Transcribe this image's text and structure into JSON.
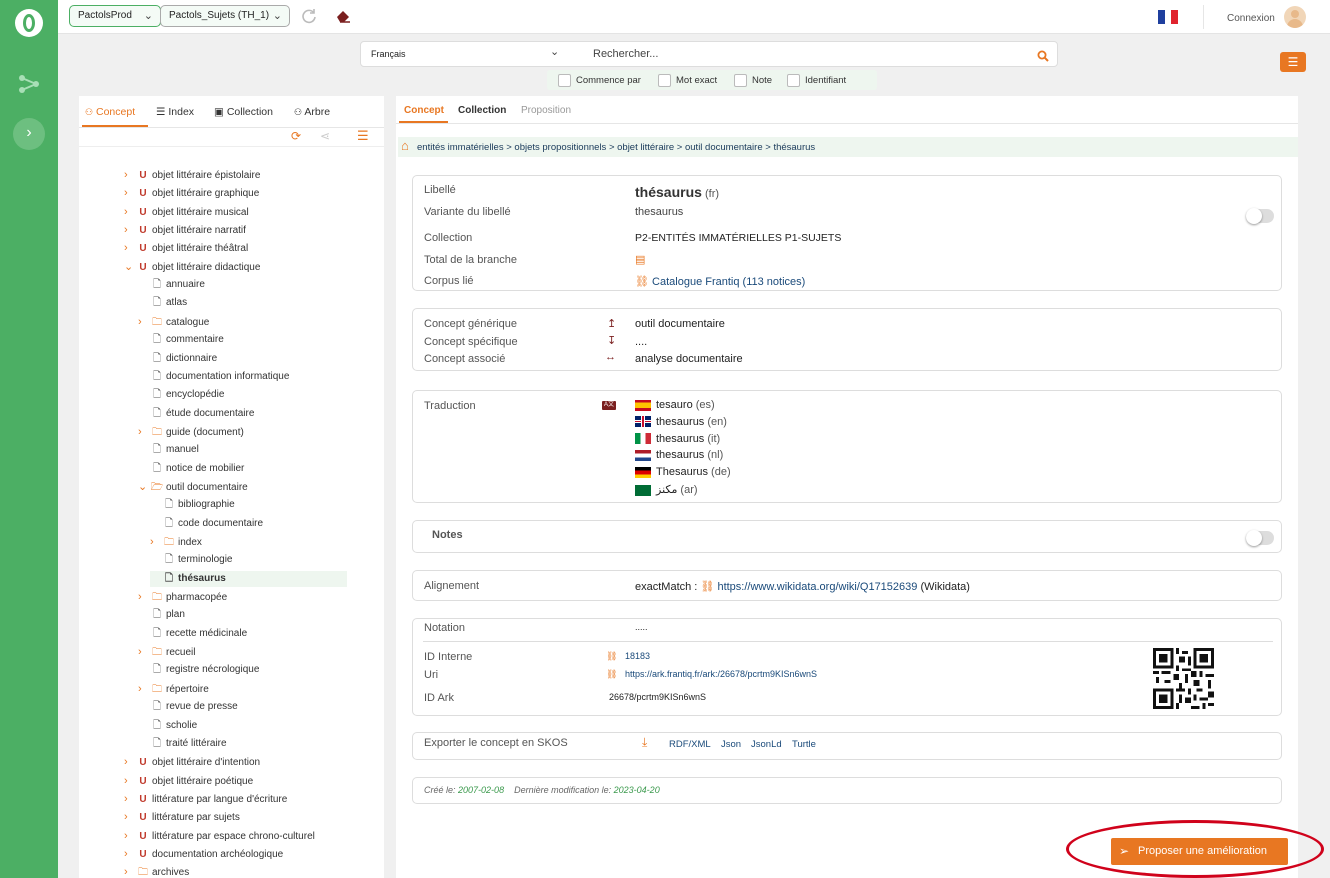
{
  "topbar": {
    "thesaurus_select": "PactolsProd",
    "group_select": "Pactols_Sujets (TH_1)",
    "login": "Connexion"
  },
  "search": {
    "language": "Français",
    "placeholder": "Rechercher...",
    "options": [
      "Commence par",
      "Mot exact",
      "Note",
      "Identifiant"
    ]
  },
  "left_tabs": [
    "Concept",
    "Index",
    "Collection",
    "Arbre"
  ],
  "tree": [
    {
      "label": "objet littéraire épistolaire",
      "level": 0,
      "icon": "magnet",
      "arrow": "right"
    },
    {
      "label": "objet littéraire graphique",
      "level": 0,
      "icon": "magnet",
      "arrow": "right"
    },
    {
      "label": "objet littéraire musical",
      "level": 0,
      "icon": "magnet",
      "arrow": "right"
    },
    {
      "label": "objet littéraire narratif",
      "level": 0,
      "icon": "magnet",
      "arrow": "right"
    },
    {
      "label": "objet littéraire théâtral",
      "level": 0,
      "icon": "magnet",
      "arrow": "right"
    },
    {
      "label": "objet littéraire didactique",
      "level": 0,
      "icon": "magnet",
      "arrow": "down"
    },
    {
      "label": "annuaire",
      "level": 1,
      "icon": "doc",
      "arrow": ""
    },
    {
      "label": "atlas",
      "level": 1,
      "icon": "doc",
      "arrow": ""
    },
    {
      "label": "catalogue",
      "level": 1,
      "icon": "folder",
      "arrow": "right"
    },
    {
      "label": "commentaire",
      "level": 1,
      "icon": "doc",
      "arrow": ""
    },
    {
      "label": "dictionnaire",
      "level": 1,
      "icon": "doc",
      "arrow": ""
    },
    {
      "label": "documentation informatique",
      "level": 1,
      "icon": "doc",
      "arrow": ""
    },
    {
      "label": "encyclopédie",
      "level": 1,
      "icon": "doc",
      "arrow": ""
    },
    {
      "label": "étude documentaire",
      "level": 1,
      "icon": "doc",
      "arrow": ""
    },
    {
      "label": "guide (document)",
      "level": 1,
      "icon": "folder",
      "arrow": "right"
    },
    {
      "label": "manuel",
      "level": 1,
      "icon": "doc",
      "arrow": ""
    },
    {
      "label": "notice de mobilier",
      "level": 1,
      "icon": "doc",
      "arrow": ""
    },
    {
      "label": "outil documentaire",
      "level": 1,
      "icon": "folder-open",
      "arrow": "down"
    },
    {
      "label": "bibliographie",
      "level": 2,
      "icon": "doc",
      "arrow": ""
    },
    {
      "label": "code documentaire",
      "level": 2,
      "icon": "doc",
      "arrow": ""
    },
    {
      "label": "index",
      "level": 2,
      "icon": "folder",
      "arrow": "right"
    },
    {
      "label": "terminologie",
      "level": 2,
      "icon": "doc",
      "arrow": ""
    },
    {
      "label": "thésaurus",
      "level": 2,
      "icon": "doc",
      "arrow": "",
      "selected": true
    },
    {
      "label": "pharmacopée",
      "level": 1,
      "icon": "folder",
      "arrow": "right"
    },
    {
      "label": "plan",
      "level": 1,
      "icon": "doc",
      "arrow": ""
    },
    {
      "label": "recette médicinale",
      "level": 1,
      "icon": "doc",
      "arrow": ""
    },
    {
      "label": "recueil",
      "level": 1,
      "icon": "folder",
      "arrow": "right"
    },
    {
      "label": "registre nécrologique",
      "level": 1,
      "icon": "doc",
      "arrow": ""
    },
    {
      "label": "répertoire",
      "level": 1,
      "icon": "folder",
      "arrow": "right"
    },
    {
      "label": "revue de presse",
      "level": 1,
      "icon": "doc",
      "arrow": ""
    },
    {
      "label": "scholie",
      "level": 1,
      "icon": "doc",
      "arrow": ""
    },
    {
      "label": "traité littéraire",
      "level": 1,
      "icon": "doc",
      "arrow": ""
    },
    {
      "label": "objet littéraire d'intention",
      "level": 0,
      "icon": "magnet",
      "arrow": "right"
    },
    {
      "label": "objet littéraire poétique",
      "level": 0,
      "icon": "magnet",
      "arrow": "right"
    },
    {
      "label": "littérature par langue d'écriture",
      "level": 0,
      "icon": "magnet",
      "arrow": "right"
    },
    {
      "label": "littérature par sujets",
      "level": 0,
      "icon": "magnet",
      "arrow": "right"
    },
    {
      "label": "littérature par espace chrono-culturel",
      "level": 0,
      "icon": "magnet",
      "arrow": "right"
    },
    {
      "label": "documentation archéologique",
      "level": 0,
      "icon": "magnet",
      "arrow": "right"
    },
    {
      "label": "archives",
      "level": 0,
      "icon": "folder",
      "arrow": "right"
    }
  ],
  "right_tabs": [
    "Concept",
    "Collection",
    "Proposition"
  ],
  "breadcrumb": "entités immatérielles > objets propositionnels > objet littéraire > outil documentaire > thésaurus",
  "concept": {
    "libelle_label": "Libellé",
    "libelle_value": "thésaurus",
    "libelle_lang": "(fr)",
    "variante_label": "Variante du libellé",
    "variante_value": "thesaurus",
    "collection_label": "Collection",
    "collection_value": "P2-ENTITÉS IMMATÉRIELLES  P1-SUJETS",
    "total_label": "Total de la branche",
    "corpus_label": "Corpus lié",
    "corpus_value": "Catalogue Frantiq (113 notices)"
  },
  "relations": {
    "generic_label": "Concept générique",
    "generic_value": "outil documentaire",
    "specific_label": "Concept spécifique",
    "specific_value": "....",
    "assoc_label": "Concept associé",
    "assoc_value": "analyse documentaire"
  },
  "translation": {
    "label": "Traduction",
    "items": [
      {
        "term": "tesauro",
        "lang": "(es)"
      },
      {
        "term": "thesaurus",
        "lang": "(en)"
      },
      {
        "term": "thesaurus",
        "lang": "(it)"
      },
      {
        "term": "thesaurus",
        "lang": "(nl)"
      },
      {
        "term": "Thesaurus",
        "lang": "(de)"
      },
      {
        "term": "مكنز",
        "lang": "(ar)"
      }
    ]
  },
  "notes": {
    "label": "Notes"
  },
  "alignement": {
    "label": "Alignement",
    "type": "exactMatch :",
    "url": "https://www.wikidata.org/wiki/Q17152639",
    "source": "(Wikidata)"
  },
  "ids": {
    "notation_label": "Notation",
    "notation_value": ".....",
    "id_interne_label": "ID Interne",
    "id_interne_value": "18183",
    "uri_label": "Uri",
    "uri_value": "https://ark.frantiq.fr/ark:/26678/pcrtm9KISn6wnS",
    "ark_label": "ID Ark",
    "ark_value": "26678/pcrtm9KISn6wnS"
  },
  "export": {
    "label": "Exporter le concept en SKOS",
    "formats": [
      "RDF/XML",
      "Json",
      "JsonLd",
      "Turtle"
    ]
  },
  "dates": {
    "created_label": "Créé le:",
    "created_value": "2007-02-08",
    "modified_label": "Dernière modification le:",
    "modified_value": "2023-04-20"
  },
  "propose_button": "Proposer une amélioration",
  "colors": {
    "green": "#4caf64",
    "orange": "#e87722",
    "highlight_ring": "#d0021b"
  }
}
